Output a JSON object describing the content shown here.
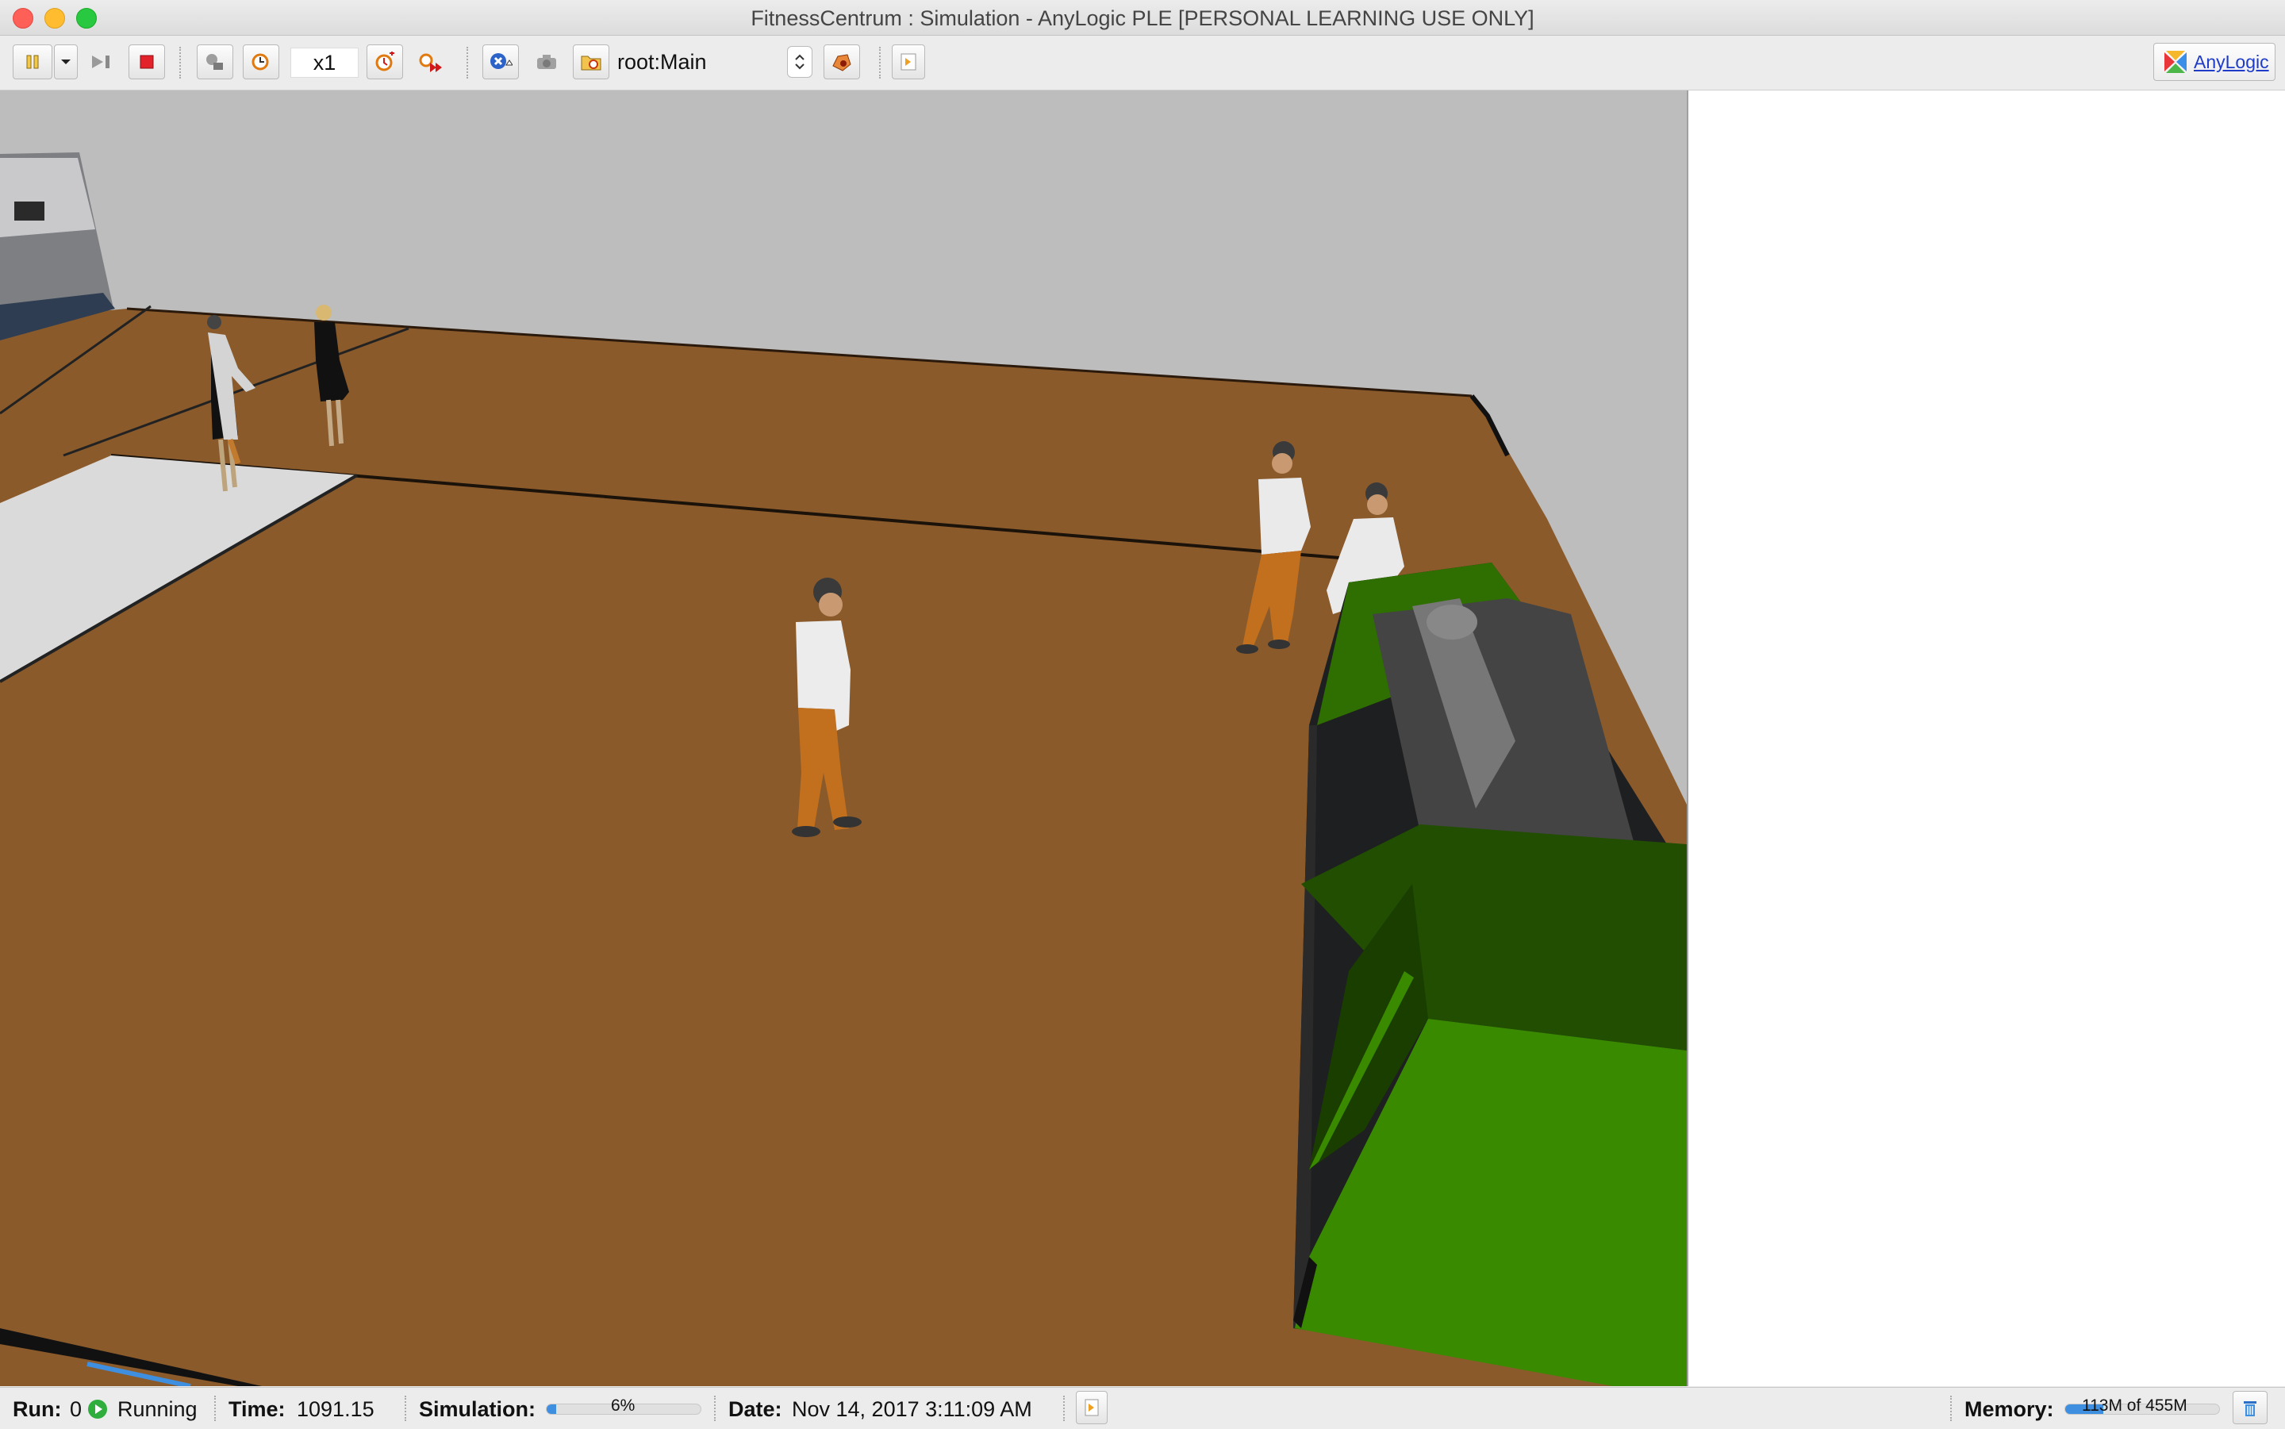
{
  "window": {
    "title": "FitnessCentrum : Simulation - AnyLogic PLE [PERSONAL LEARNING USE ONLY]"
  },
  "toolbar": {
    "speed_label": "x1",
    "agent_selector_value": "root:Main",
    "brand_link": "AnyLogic"
  },
  "status": {
    "run_label": "Run:",
    "run_value": "0",
    "state": "Running",
    "time_label": "Time:",
    "time_value": "1091.15",
    "simulation_label": "Simulation:",
    "simulation_progress_text": "6%",
    "simulation_progress": 0.06,
    "date_label": "Date:",
    "date_value": "Nov 14, 2017 3:11:09 AM",
    "memory_label": "Memory:",
    "memory_text": "113M of 455M",
    "memory_fraction": 0.248
  },
  "colors": {
    "floor": "#8a5a2b",
    "wall": "#bebebe",
    "machine_green": "#3a8a00",
    "accent_blue": "#3f8fe0"
  },
  "icons": {
    "pause": "pause-icon",
    "step": "step-icon",
    "stop": "stop-icon",
    "run_until": "run-until-icon",
    "slow_down": "slow-down-icon",
    "speed_up": "speed-up-icon",
    "max_speed": "max-speed-icon",
    "navigate_up": "navigate-up-icon",
    "camera": "camera-icon",
    "agent_folder": "agent-folder-icon",
    "view_area": "view-area-icon",
    "console": "console-icon",
    "trash": "trash-icon"
  }
}
